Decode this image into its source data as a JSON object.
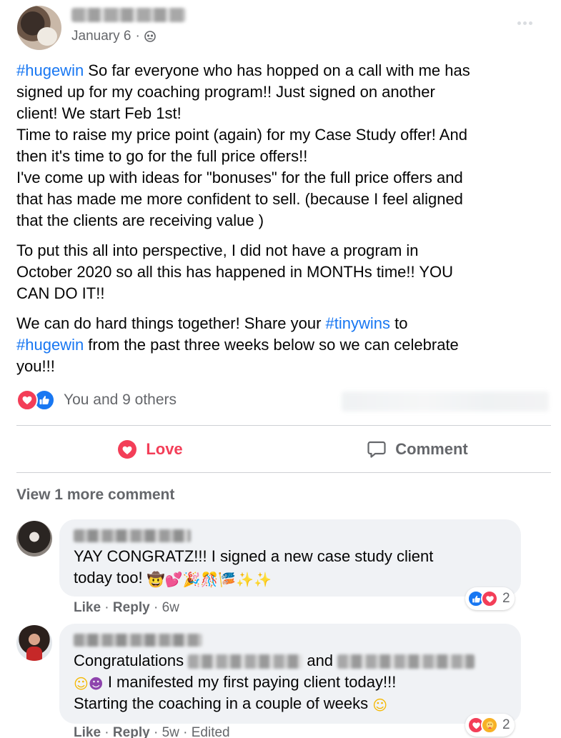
{
  "post": {
    "date": "January 6",
    "separator": "·",
    "privacy_icon": "group-icon",
    "lines": [
      [
        "#hugewin",
        " So far everyone who has hopped on a call with me has"
      ],
      "signed up for my coaching program!! Just signed on another",
      "client! We start Feb 1st!",
      "Time to raise my price point (again) for my Case Study offer! And",
      "then it's time to go for the full price offers!!",
      "I've come up with ideas for \"bonuses\" for the full price offers and",
      "that has made me more confident to sell.  (because I feel aligned",
      "that the clients are receiving value )"
    ],
    "p1_hashtag": "#hugewin",
    "p1_l1_rest": " So far everyone who has hopped on a call with me has",
    "p1_l2": "signed up for my coaching program!! Just signed on another",
    "p1_l3": "client! We start Feb 1st!",
    "p1_l4": "Time to raise my price point (again) for my Case Study offer! And",
    "p1_l5": "then it's time to go for the full price offers!!",
    "p1_l6": "I've come up with ideas for \"bonuses\" for the full price offers and",
    "p1_l7": "that has made me more confident to sell.  (because I feel aligned",
    "p1_l8": "that the clients are receiving value )",
    "p2_l1": "To put this all into perspective, I did not have a program in",
    "p2_l2": "October 2020 so all this has happened in MONTHs time!! YOU",
    "p2_l3": "CAN DO IT!!",
    "p3_l1_a": "We can do hard things together!  Share your ",
    "p3_l1_tag": "#tinywins",
    "p3_l1_b": " to",
    "p3_l2_tag": "#hugewin",
    "p3_l2_rest": " from the past three weeks below so we can celebrate",
    "p3_l3": "you!!!"
  },
  "reactions": {
    "summary": "You and 9 others",
    "icons": [
      "love-reaction-icon",
      "like-reaction-icon"
    ]
  },
  "actions": {
    "love_label": "Love",
    "comment_label": "Comment"
  },
  "comments_section": {
    "view_more": "View 1 more comment"
  },
  "comments": [
    {
      "line1": "YAY CONGRATZ!!! I signed a new case study client",
      "line2": "today too! ",
      "emojis": [
        "🤠",
        "💕",
        "🎉",
        "🎊",
        "🎏",
        "✨",
        "✨"
      ],
      "reaction_count": "2",
      "like": "Like",
      "reply": "Reply",
      "time": "6w"
    },
    {
      "line1_a": "Congratulations ",
      "line1_b": " and ",
      "line2_text": " I manifested my first paying client today!!!",
      "line3": "Starting the coaching in a couple of weeks ",
      "reaction_count": "2",
      "like": "Like",
      "reply": "Reply",
      "time": "5w",
      "edited": "Edited"
    }
  ],
  "colors": {
    "love": "#f33e58",
    "like": "#1877f2",
    "secondary_text": "#65676b",
    "bubble": "#f0f2f5",
    "hashtag": "#1877f2"
  }
}
